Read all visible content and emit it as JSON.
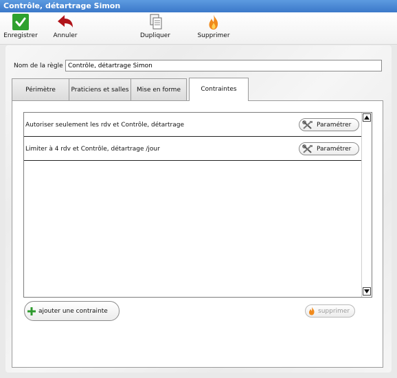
{
  "window": {
    "title": "Contrôle, détartrage Simon"
  },
  "toolbar": {
    "save_label": "Enregistrer",
    "cancel_label": "Annuler",
    "duplicate_label": "Dupliquer",
    "delete_label": "Supprimer"
  },
  "rule": {
    "name_label": "Nom de la règle :",
    "name_value": "Contrôle, détartrage Simon"
  },
  "tabs": [
    {
      "label": "Périmètre"
    },
    {
      "label": "Praticiens et salles"
    },
    {
      "label": "Mise en forme"
    },
    {
      "label": "Contraintes",
      "active": true
    }
  ],
  "constraints": [
    {
      "text": "Autoriser seulement les  rdv  et Contrôle, détartrage",
      "button": "Paramétrer"
    },
    {
      "text": "Limiter à 4 rdv  et Contrôle, détartrage /jour",
      "button": "Paramétrer"
    }
  ],
  "actions": {
    "add_label": "ajouter une contrainte",
    "remove_label": "supprimer"
  },
  "colors": {
    "title_bar": "#3b78c9",
    "save_green": "#2ea12e",
    "cancel_red": "#b0141a",
    "add_green": "#2e9a2e",
    "flame_orange": "#f08a1c"
  }
}
